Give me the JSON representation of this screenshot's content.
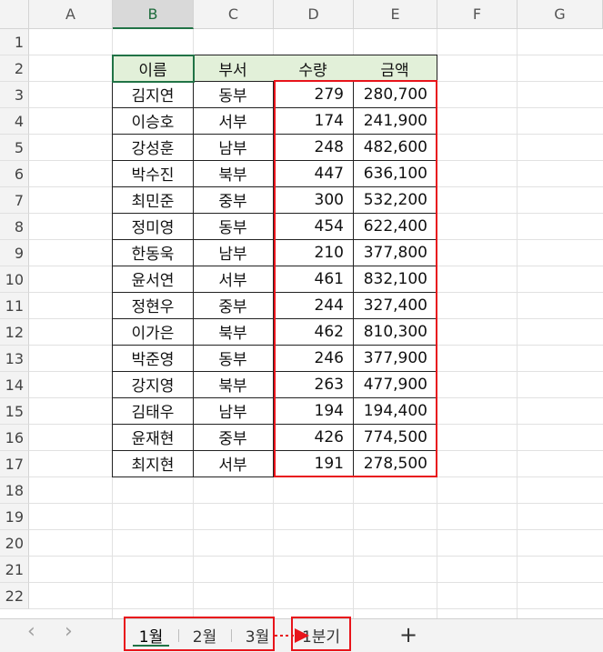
{
  "columns": [
    "A",
    "B",
    "C",
    "D",
    "E",
    "F",
    "G"
  ],
  "rows": [
    "1",
    "2",
    "3",
    "4",
    "5",
    "6",
    "7",
    "8",
    "9",
    "10",
    "11",
    "12",
    "13",
    "14",
    "15",
    "16",
    "17",
    "18",
    "19",
    "20",
    "21",
    "22"
  ],
  "table": {
    "headers": [
      "이름",
      "부서",
      "수량",
      "금액"
    ],
    "data": [
      [
        "김지연",
        "동부",
        "279",
        "280,700"
      ],
      [
        "이승호",
        "서부",
        "174",
        "241,900"
      ],
      [
        "강성훈",
        "남부",
        "248",
        "482,600"
      ],
      [
        "박수진",
        "북부",
        "447",
        "636,100"
      ],
      [
        "최민준",
        "중부",
        "300",
        "532,200"
      ],
      [
        "정미영",
        "동부",
        "454",
        "622,400"
      ],
      [
        "한동욱",
        "남부",
        "210",
        "377,800"
      ],
      [
        "윤서연",
        "서부",
        "461",
        "832,100"
      ],
      [
        "정현우",
        "중부",
        "244",
        "327,400"
      ],
      [
        "이가은",
        "북부",
        "462",
        "810,300"
      ],
      [
        "박준영",
        "동부",
        "246",
        "377,900"
      ],
      [
        "강지영",
        "북부",
        "263",
        "477,900"
      ],
      [
        "김태우",
        "남부",
        "194",
        "194,400"
      ],
      [
        "윤재현",
        "중부",
        "426",
        "774,500"
      ],
      [
        "최지현",
        "서부",
        "191",
        "278,500"
      ]
    ]
  },
  "selected_column": "B",
  "sheet_tabs": [
    "1월",
    "2월",
    "3월",
    "1분기"
  ],
  "active_tab": "1월",
  "add_sheet": "+",
  "nav": {
    "prev": "‹",
    "next": "›"
  },
  "colors": {
    "highlight": "#e8141b",
    "header_fill": "#e2f0d9",
    "excel_green": "#217346"
  }
}
